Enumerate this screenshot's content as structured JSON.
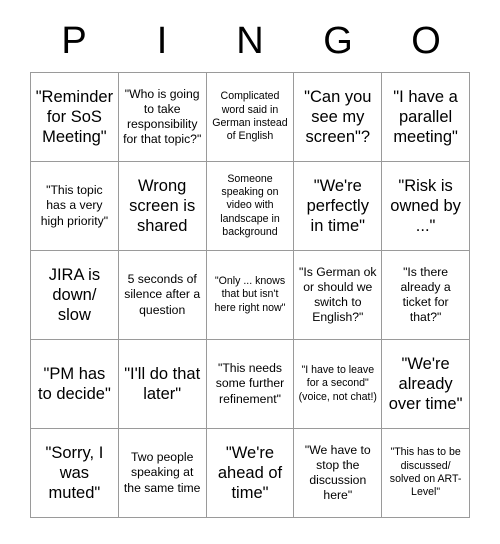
{
  "header": {
    "letters": [
      "P",
      "I",
      "N",
      "G",
      "O"
    ]
  },
  "grid": {
    "rows": 5,
    "columns": 5,
    "border_color": "#9a9a9a",
    "background_color": "#ffffff",
    "text_color": "#000000",
    "cells": [
      {
        "text": "\"Reminder for SoS Meeting\"",
        "size": "lg"
      },
      {
        "text": "\"Who is going to take responsibility for that topic?\"",
        "size": "md"
      },
      {
        "text": "Complicated word said in German instead of English",
        "size": "sm"
      },
      {
        "text": "\"Can you see my screen\"?",
        "size": "lg"
      },
      {
        "text": "\"I have a parallel meeting\"",
        "size": "lg"
      },
      {
        "text": "\"This topic has a very high priority\"",
        "size": "md"
      },
      {
        "text": "Wrong screen is shared",
        "size": "lg"
      },
      {
        "text": "Someone speaking on video with landscape in background",
        "size": "sm"
      },
      {
        "text": "\"We're perfectly in time\"",
        "size": "lg"
      },
      {
        "text": "\"Risk is owned by ...\"",
        "size": "lg"
      },
      {
        "text": "JIRA is down/ slow",
        "size": "lg"
      },
      {
        "text": "5 seconds of silence after a question",
        "size": "md"
      },
      {
        "text": "\"Only ... knows that but isn't here right now\"",
        "size": "sm"
      },
      {
        "text": "\"Is German ok or should we switch to English?\"",
        "size": "md"
      },
      {
        "text": "\"Is there already a ticket for that?\"",
        "size": "md"
      },
      {
        "text": "\"PM has to decide\"",
        "size": "lg"
      },
      {
        "text": "\"I'll do that later\"",
        "size": "lg"
      },
      {
        "text": "\"This needs some further refinement\"",
        "size": "md"
      },
      {
        "text": "\"I have to leave for a second\" (voice, not chat!)",
        "size": "sm"
      },
      {
        "text": "\"We're already over time\"",
        "size": "lg"
      },
      {
        "text": "\"Sorry, I was muted\"",
        "size": "lg"
      },
      {
        "text": "Two people speaking at the same time",
        "size": "md"
      },
      {
        "text": "\"We're ahead of time\"",
        "size": "lg"
      },
      {
        "text": "\"We have to stop the discussion here\"",
        "size": "md"
      },
      {
        "text": "\"This has to be discussed/ solved on ART-Level\"",
        "size": "sm"
      }
    ]
  }
}
